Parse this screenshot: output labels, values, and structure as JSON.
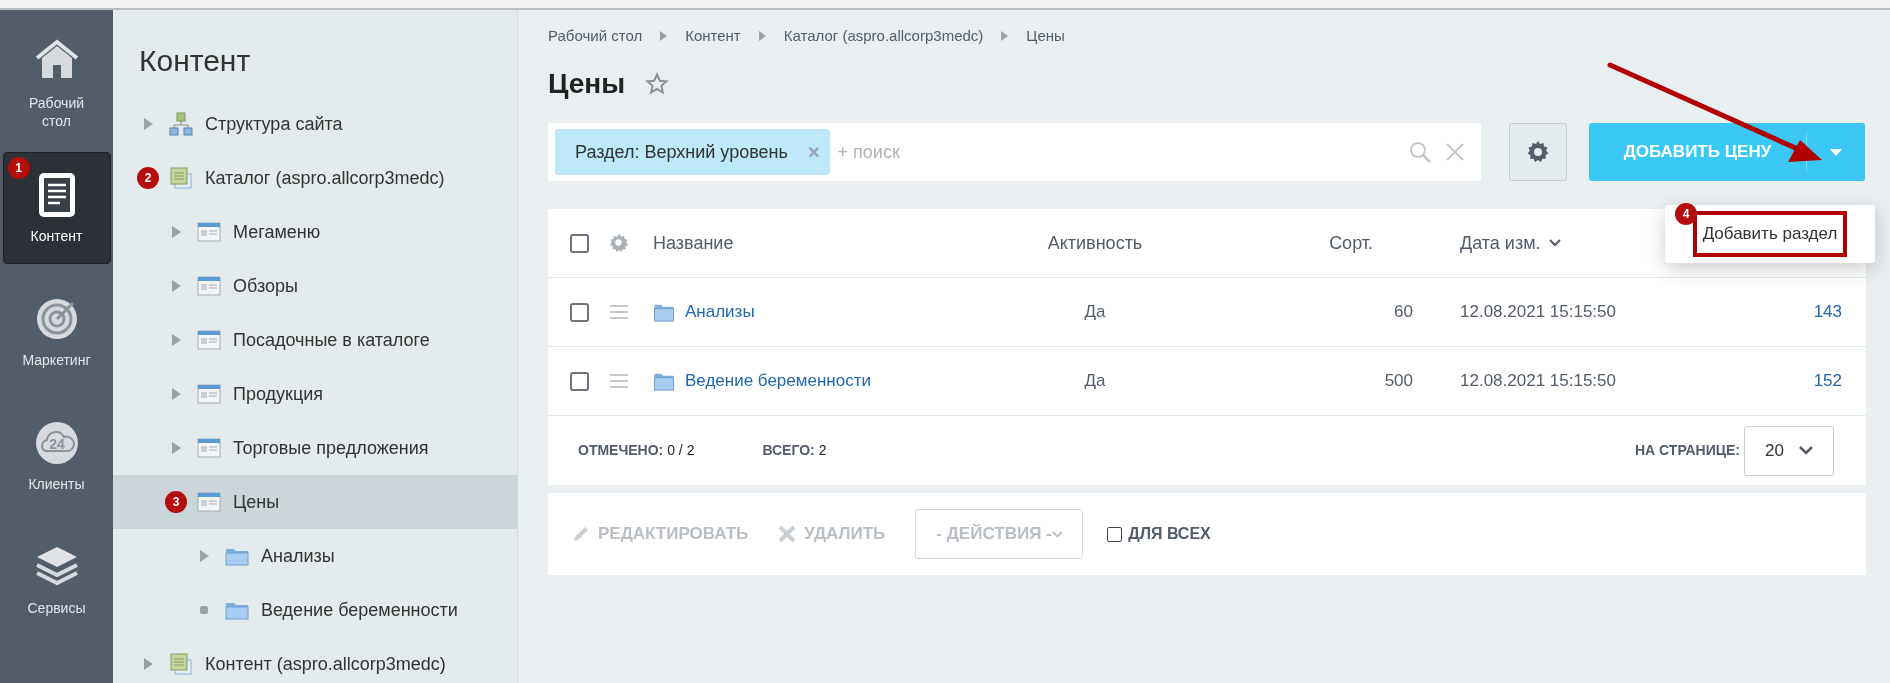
{
  "nav": [
    {
      "label": "Рабочий стол",
      "kind": "house",
      "selected": false
    },
    {
      "label": "Контент",
      "kind": "document",
      "selected": true,
      "badge": "1"
    },
    {
      "label": "Маркетинг",
      "kind": "target",
      "selected": false
    },
    {
      "label": "Клиенты",
      "kind": "cloud",
      "icon_text": "24",
      "selected": false
    },
    {
      "label": "Сервисы",
      "kind": "layers",
      "selected": false
    }
  ],
  "sidebar": {
    "title": "Контент",
    "tree": [
      {
        "label": "Структура сайта",
        "kind": "sitemap",
        "expanded": false,
        "leaf": false,
        "selected": false
      },
      {
        "label": "Каталог (aspro.allcorp3medc)",
        "kind": "catalog",
        "expanded": true,
        "selected": false,
        "badge": "2",
        "children": [
          {
            "label": "Мегаменю",
            "kind": "list",
            "expanded": false,
            "leaf": false,
            "selected": false
          },
          {
            "label": "Обзоры",
            "kind": "list",
            "expanded": false,
            "leaf": false,
            "selected": false
          },
          {
            "label": "Посадочные в каталоге",
            "kind": "list",
            "expanded": false,
            "leaf": false,
            "selected": false
          },
          {
            "label": "Продукция",
            "kind": "list",
            "expanded": false,
            "leaf": false,
            "selected": false
          },
          {
            "label": "Торговые предложения",
            "kind": "list",
            "expanded": false,
            "leaf": false,
            "selected": false
          },
          {
            "label": "Цены",
            "kind": "list",
            "expanded": true,
            "selected": true,
            "badge": "3",
            "children": [
              {
                "label": "Анализы",
                "kind": "folder",
                "expanded": false,
                "leaf": false,
                "selected": false
              },
              {
                "label": "Ведение беременности",
                "kind": "folder",
                "expanded": false,
                "leaf": true,
                "selected": false
              }
            ]
          }
        ]
      },
      {
        "label": "Контент (aspro.allcorp3medc)",
        "kind": "catalog",
        "expanded": false,
        "leaf": false,
        "selected": false
      }
    ]
  },
  "breadcrumbs": [
    "Рабочий стол",
    "Контент",
    "Каталог (aspro.allcorp3medc)",
    "Цены"
  ],
  "title": "Цены",
  "filter": {
    "tag": "Раздел: Верхний уровень",
    "tag_remove": "×",
    "placeholder": "+ поиск"
  },
  "add_button": {
    "label": "ДОБАВИТЬ ЦЕНУ"
  },
  "dropdown": {
    "badge": "4",
    "items": [
      {
        "label": "Добавить раздел",
        "highlighted": true
      }
    ]
  },
  "table": {
    "select_all": {
      "checked": false
    },
    "columns": [
      {
        "label": "Название",
        "sorted": false
      },
      {
        "label": "Активность",
        "sorted": false
      },
      {
        "label": "Сорт.",
        "sorted": false
      },
      {
        "label": "Дата изм.",
        "sorted": true
      }
    ],
    "rows": [
      {
        "name": "Анализы",
        "active": "Да",
        "sort": "60",
        "date": "12.08.2021 15:15:50",
        "id": "143",
        "checked": false
      },
      {
        "name": "Ведение беременности",
        "active": "Да",
        "sort": "500",
        "date": "12.08.2021 15:15:50",
        "id": "152",
        "checked": false
      }
    ],
    "footer": {
      "checked_label": "ОТМЕЧЕНО:",
      "checked_value": "0 / 2",
      "total_label": "ВСЕГО:",
      "total_value": "2",
      "per_page_label": "НА СТРАНИЦЕ:",
      "per_page_value": "20"
    }
  },
  "actions": {
    "edit": "РЕДАКТИРОВАТЬ",
    "delete": "УДАЛИТЬ",
    "select": "- ДЕЙСТВИЯ -",
    "for_all": {
      "label": "ДЛЯ ВСЕХ",
      "checked": false
    }
  }
}
